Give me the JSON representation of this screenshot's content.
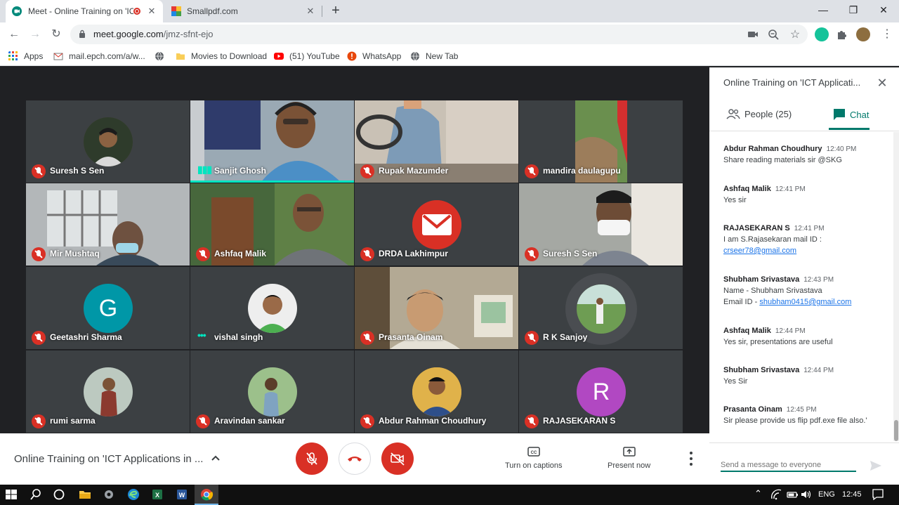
{
  "browser": {
    "tabs": [
      {
        "title": "Meet - Online Training on 'IC",
        "active": true
      },
      {
        "title": "Smallpdf.com",
        "active": false
      }
    ],
    "url_host": "meet.google.com",
    "url_path": "/jmz-sfnt-ejo",
    "bookmarks": [
      {
        "label": "Apps",
        "icon": "apps-grid-icon"
      },
      {
        "label": "mail.epch.com/a/w...",
        "icon": "mail-icon"
      },
      {
        "label": "",
        "icon": "globe-icon"
      },
      {
        "label": "Movies to Download",
        "icon": "folder-icon"
      },
      {
        "label": "(51) YouTube",
        "icon": "youtube-icon"
      },
      {
        "label": "WhatsApp",
        "icon": "whatsapp-icon"
      },
      {
        "label": "New Tab",
        "icon": "globe-icon"
      }
    ]
  },
  "participants": [
    {
      "name": "Suresh S Sen",
      "state": "muted",
      "kind": "avatar"
    },
    {
      "name": "Sanjit Ghosh",
      "state": "speaking",
      "kind": "video"
    },
    {
      "name": "Rupak Mazumder",
      "state": "muted",
      "kind": "video"
    },
    {
      "name": "mandira daulagupu",
      "state": "muted",
      "kind": "video"
    },
    {
      "name": "Mir Mushtaq",
      "state": "muted",
      "kind": "video"
    },
    {
      "name": "Ashfaq Malik",
      "state": "muted",
      "kind": "video"
    },
    {
      "name": "DRDA Lakhimpur",
      "state": "muted",
      "kind": "avatar"
    },
    {
      "name": "Suresh S Sen",
      "state": "muted",
      "kind": "video"
    },
    {
      "name": "Geetashri Sharma",
      "state": "muted",
      "kind": "letter",
      "letter": "G",
      "color": "#0097a7"
    },
    {
      "name": "vishal singh",
      "state": "active",
      "kind": "avatar"
    },
    {
      "name": "Prasanta Oinam",
      "state": "muted",
      "kind": "video"
    },
    {
      "name": "R K Sanjoy",
      "state": "muted",
      "kind": "avatar"
    },
    {
      "name": "rumi sarma",
      "state": "muted",
      "kind": "avatar"
    },
    {
      "name": "Aravindan sankar",
      "state": "muted",
      "kind": "avatar"
    },
    {
      "name": "Abdur Rahman Choudhury",
      "state": "muted",
      "kind": "avatar"
    },
    {
      "name": "RAJASEKARAN S",
      "state": "muted",
      "kind": "letter",
      "letter": "R",
      "color": "#b148c2"
    }
  ],
  "panel": {
    "title": "Online Training on 'ICT Applicati...",
    "people_label": "People (25)",
    "chat_label": "Chat",
    "send_placeholder": "Send a message to everyone"
  },
  "messages": [
    {
      "sender": "Abdur Rahman Choudhury",
      "time": "12:40 PM",
      "lines": [
        "Share reading materials sir @SKG"
      ]
    },
    {
      "sender": "Ashfaq Malik",
      "time": "12:41 PM",
      "lines": [
        "Yes sir"
      ]
    },
    {
      "sender": "RAJASEKARAN S",
      "time": "12:41 PM",
      "lines": [
        "I am S.Rajasekaran mail ID :"
      ],
      "link": "crseer78@gmail.com"
    },
    {
      "sender": "Shubham Srivastava",
      "time": "12:43 PM",
      "lines": [
        "Name - Shubham Srivastava"
      ],
      "email_prefix": "Email ID - ",
      "link": "shubham0415@gmail.com"
    },
    {
      "sender": "Ashfaq Malik",
      "time": "12:44 PM",
      "lines": [
        "Yes sir, presentations are useful"
      ]
    },
    {
      "sender": "Shubham Srivastava",
      "time": "12:44 PM",
      "lines": [
        "Yes Sir"
      ]
    },
    {
      "sender": "Prasanta Oinam",
      "time": "12:45 PM",
      "lines": [
        "Sir please provide us flip pdf.exe file also.'"
      ]
    }
  ],
  "bottombar": {
    "meeting_title": "Online Training on 'ICT Applications in ...",
    "captions_label": "Turn on captions",
    "present_label": "Present now"
  },
  "taskbar": {
    "language": "ENG",
    "time": "12:45"
  },
  "colors": {
    "meet_bg": "#202124",
    "mute_red": "#d93025",
    "chat_accent": "#00796b",
    "link": "#1a73e8"
  }
}
